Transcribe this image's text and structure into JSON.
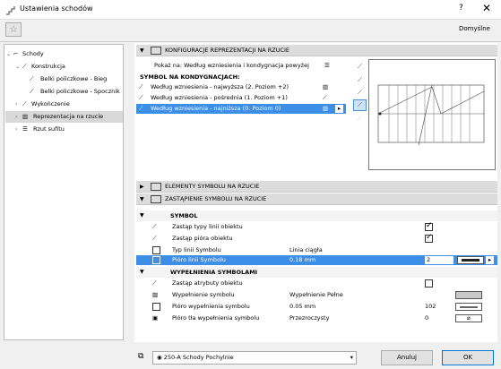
{
  "window": {
    "title": "Ustawienia schodów",
    "help": "?",
    "close": "✕"
  },
  "toolbar": {
    "favorite_icon": "star-icon",
    "preset": "Domyślne"
  },
  "tree": {
    "items": [
      {
        "label": "Schody",
        "level": 0,
        "expanded": true
      },
      {
        "label": "Konstrukcja",
        "level": 1,
        "expanded": true
      },
      {
        "label": "Belki policzkowe - Bieg",
        "level": 2
      },
      {
        "label": "Belki policzkowe - Spocznik",
        "level": 2
      },
      {
        "label": "Wykończenie",
        "level": 1,
        "expanded": false
      },
      {
        "label": "Reprezentacja na rzucie",
        "level": 1,
        "selected": true
      },
      {
        "label": "Rzut sufitu",
        "level": 1
      }
    ]
  },
  "sections": {
    "config": "KONFIGURACJE REPREZENTACJI NA RZUCIE",
    "elements": "ELEMENTY SYMBOLU NA RZUCIE",
    "override": "ZASTĄPIENIE SYMBOLU NA RZUCIE"
  },
  "config": {
    "show_label": "Pokaż na: Według wzniesienia i kondygnacja powyżej",
    "symbol_header": "SYMBOL NA KONDYGNACJACH:",
    "rows": [
      {
        "label": "Według wzniesienia - najwyższa (2. Poziom +2)",
        "selected": false
      },
      {
        "label": "Według wzniesienia - pośrednia (1. Poziom +1)",
        "selected": false
      },
      {
        "label": "Według wzniesienia - najniższa (0. Poziom 0)",
        "selected": true
      }
    ]
  },
  "override": {
    "symbol_header": "SYMBOL",
    "fill_header": "WYPEŁNIENIA SYMBOLAMI",
    "symbol_rows": [
      {
        "label": "Zastąp typy linii obiektu",
        "value": "",
        "checked": true
      },
      {
        "label": "Zastąp pióra obiektu",
        "value": "",
        "checked": true
      },
      {
        "label": "Typ linii Symbolu",
        "value": "Linia ciągła"
      },
      {
        "label": "Pióro linii Symbolu",
        "value": "0.18 mm",
        "num": "2",
        "selected": true
      }
    ],
    "fill_rows": [
      {
        "label": "Zastąp atrybuty obiektu",
        "value": "",
        "checked": false
      },
      {
        "label": "Wypełnienie symbolu",
        "value": "Wypełnienie Pełne"
      },
      {
        "label": "Pióro wypełnienia symbolu",
        "value": "0.05 mm",
        "num": "102"
      },
      {
        "label": "Pióro tła wypełnienia symbolu",
        "value": "Przezroczysty",
        "num": "0"
      }
    ]
  },
  "footer": {
    "layer": "250-A Schody Pochylnie",
    "cancel": "Anuluj",
    "ok": "OK"
  }
}
